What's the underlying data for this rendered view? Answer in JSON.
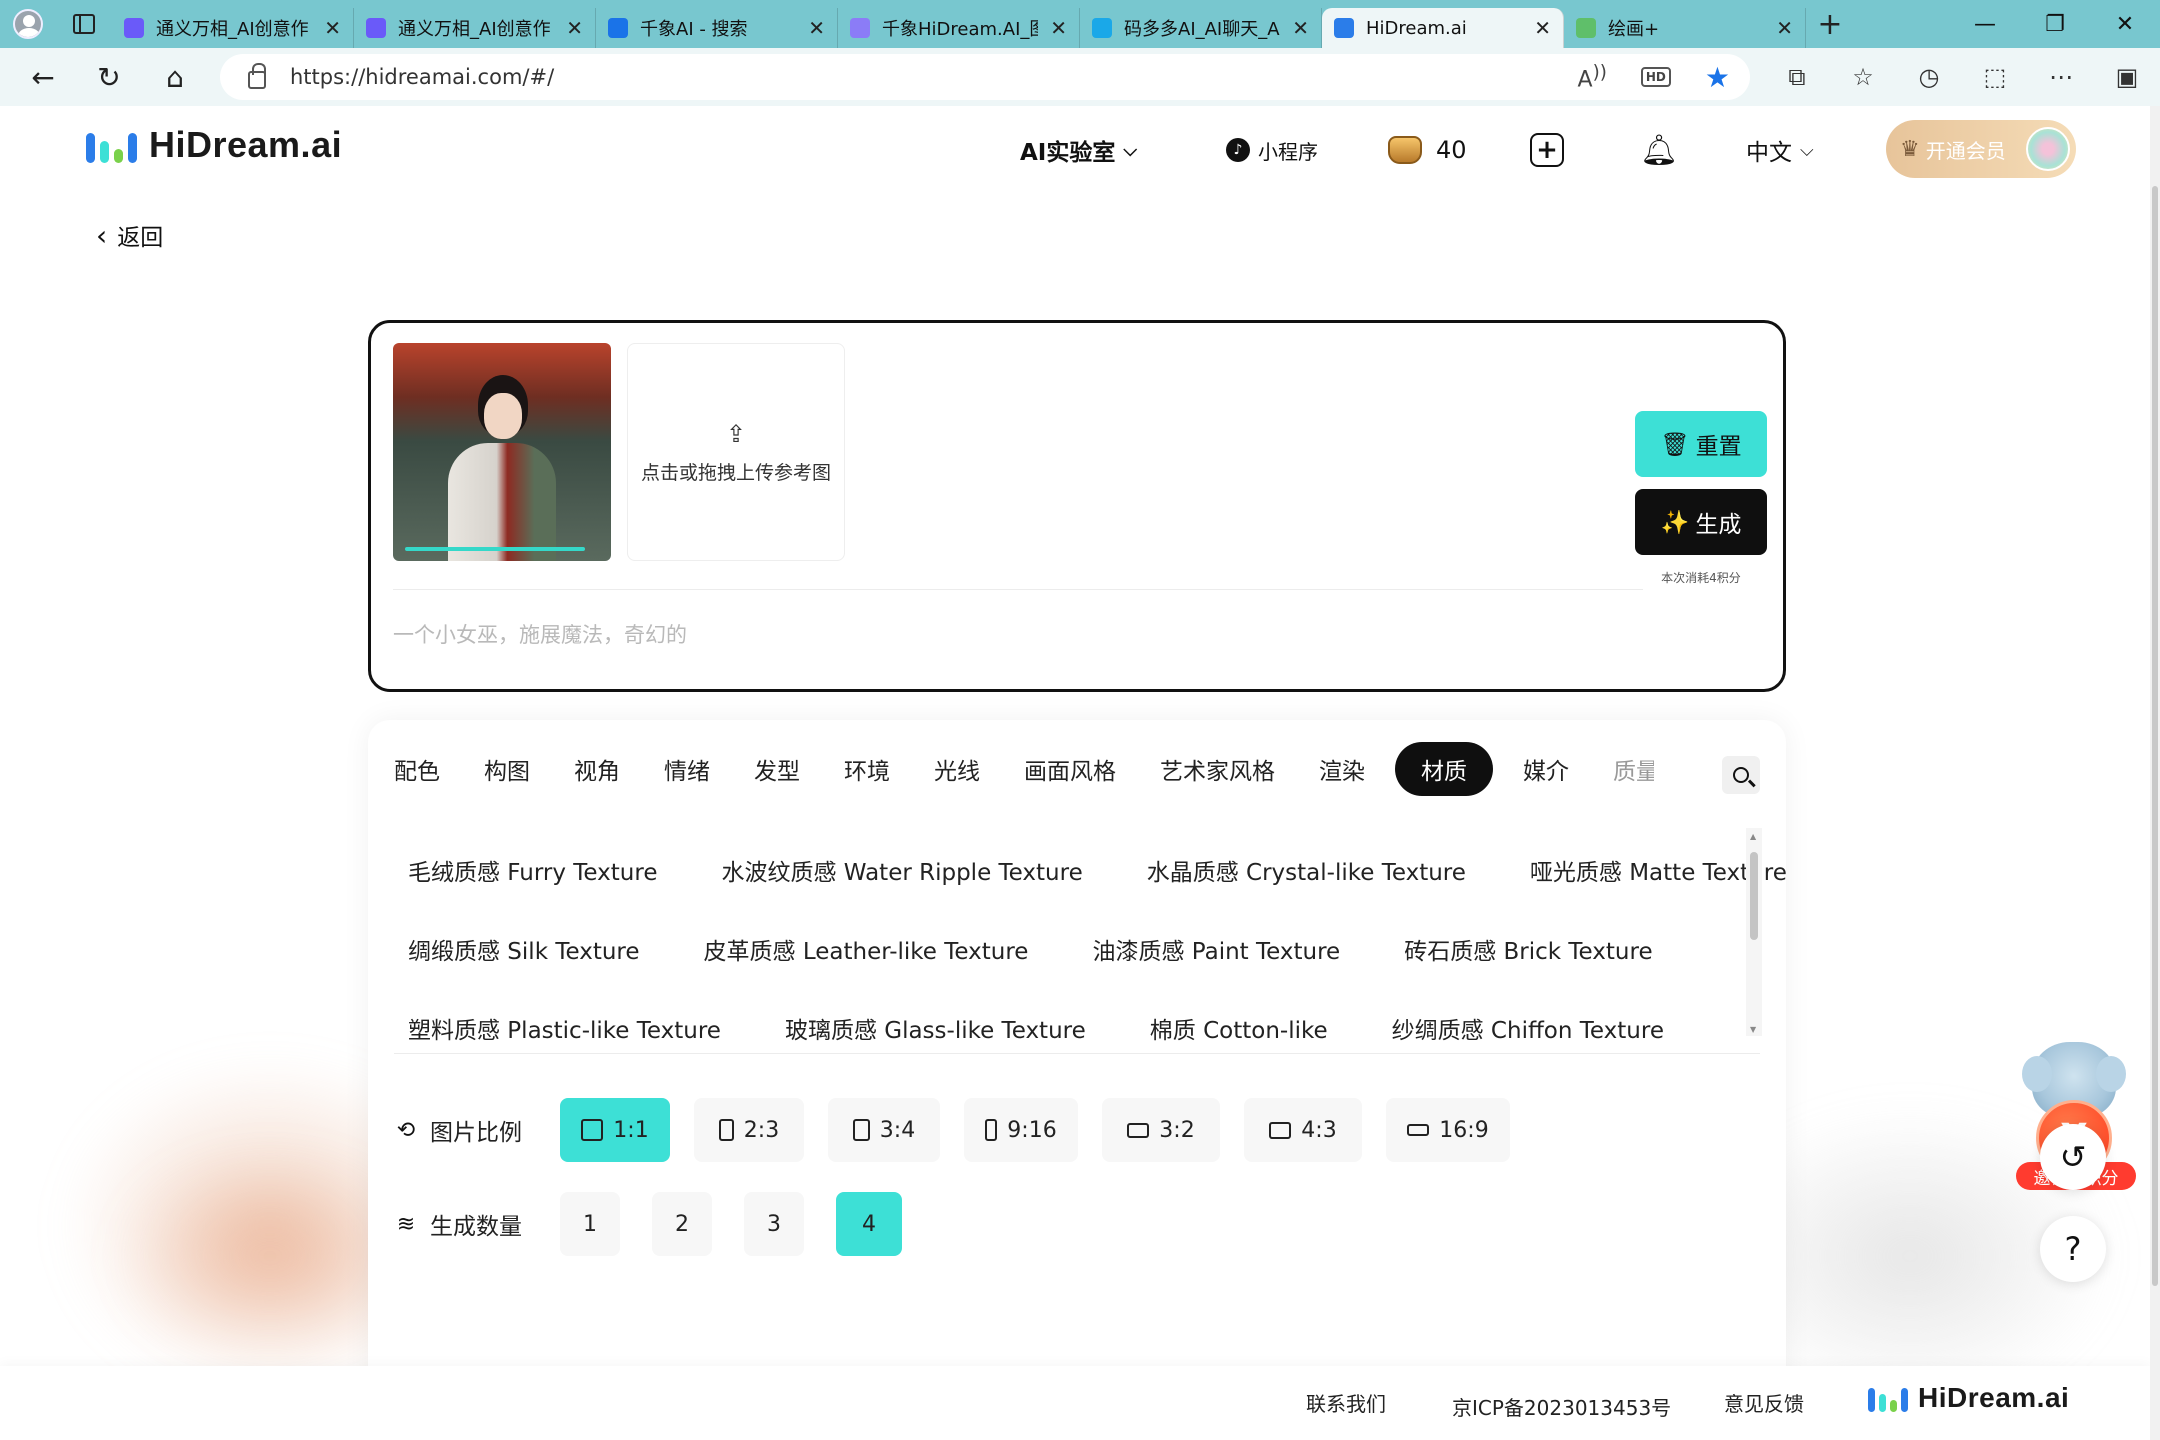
{
  "browser": {
    "tabs": [
      {
        "label": "通义万相_AI创意作",
        "favicon_color": "#6a5af9",
        "active": false
      },
      {
        "label": "通义万相_AI创意作",
        "favicon_color": "#6a5af9",
        "active": false
      },
      {
        "label": "千象AI - 搜索",
        "favicon_color": "#1a73e8",
        "active": false
      },
      {
        "label": "千象HiDream.AI_图",
        "favicon_color": "#8b7cf7",
        "active": false
      },
      {
        "label": "码多多AI_AI聊天_A",
        "favicon_color": "#1aa8e8",
        "active": false
      },
      {
        "label": "HiDream.ai",
        "favicon_color": "#2b7de9",
        "active": true
      },
      {
        "label": "绘画+",
        "favicon_color": "#5fbf6a",
        "active": false
      }
    ],
    "close_glyph": "✕",
    "new_tab_glyph": "+",
    "url": "https://hidreamai.com/#/"
  },
  "header": {
    "logo_text": "HiDream.ai",
    "ai_lab": "AI实验室",
    "mini_program": "小程序",
    "coins": "40",
    "language": "中文",
    "vip": "开通会员"
  },
  "back_label": "返回",
  "prompt": {
    "upload_hint": "点击或拖拽上传参考图",
    "placeholder": "一个小女巫，施展魔法，奇幻的",
    "reset_label": "重置",
    "generate_label": "生成",
    "cost_note": "本次消耗4积分"
  },
  "categories": [
    {
      "label": "配色",
      "active": false
    },
    {
      "label": "构图",
      "active": false
    },
    {
      "label": "视角",
      "active": false
    },
    {
      "label": "情绪",
      "active": false
    },
    {
      "label": "发型",
      "active": false
    },
    {
      "label": "环境",
      "active": false
    },
    {
      "label": "光线",
      "active": false
    },
    {
      "label": "画面风格",
      "active": false
    },
    {
      "label": "艺术家风格",
      "active": false
    },
    {
      "label": "渲染",
      "active": false
    },
    {
      "label": "材质",
      "active": true
    },
    {
      "label": "媒介",
      "active": false
    },
    {
      "label": "质量",
      "active": false
    }
  ],
  "textures": [
    [
      "毛绒质感 Furry Texture",
      "水波纹质感 Water Ripple Texture",
      "水晶质感 Crystal-like Texture",
      "哑光质感 Matte Texture"
    ],
    [
      "绸缎质感 Silk Texture",
      "皮革质感 Leather-like Texture",
      "油漆质感 Paint Texture",
      "砖石质感 Brick Texture"
    ],
    [
      "塑料质感 Plastic-like Texture",
      "玻璃质感 Glass-like Texture",
      "棉质 Cotton-like",
      "纱绸质感 Chiffon Texture"
    ]
  ],
  "ratio": {
    "label": "图片比例",
    "options": [
      {
        "label": "1:1",
        "active": true
      },
      {
        "label": "2:3",
        "active": false
      },
      {
        "label": "3:4",
        "active": false
      },
      {
        "label": "9:16",
        "active": false
      },
      {
        "label": "3:2",
        "active": false
      },
      {
        "label": "4:3",
        "active": false
      },
      {
        "label": "16:9",
        "active": false
      }
    ]
  },
  "count": {
    "label": "生成数量",
    "options": [
      {
        "label": "1",
        "active": false
      },
      {
        "label": "2",
        "active": false
      },
      {
        "label": "3",
        "active": false
      },
      {
        "label": "4",
        "active": true
      }
    ]
  },
  "invite_label": "邀请得积分",
  "help_glyph": "?",
  "footer": {
    "contact": "联系我们",
    "icp": "京ICP备2023013453号",
    "feedback": "意见反馈",
    "logo_text": "HiDream.ai"
  },
  "colors": {
    "accent": "#3de0d6",
    "dark": "#0f0f0f",
    "logo_bars": [
      "#2b7de9",
      "#3de0d6",
      "#7ad14b",
      "#2b7de9"
    ]
  }
}
